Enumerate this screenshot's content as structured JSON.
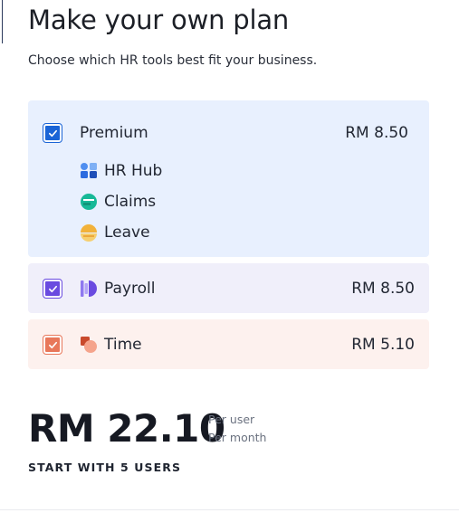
{
  "header": {
    "title": "Make your own plan",
    "subtitle": "Choose which HR tools best fit your business."
  },
  "plans": {
    "premium": {
      "name": "Premium",
      "price": "RM 8.50",
      "checked": true,
      "color": "#1a64d6",
      "features": [
        {
          "label": "HR Hub",
          "icon": "hr-hub-icon"
        },
        {
          "label": "Claims",
          "icon": "claims-icon"
        },
        {
          "label": "Leave",
          "icon": "leave-icon"
        }
      ]
    },
    "payroll": {
      "name": "Payroll",
      "price": "RM 8.50",
      "checked": true,
      "color": "#6a4be0",
      "icon": "payroll-icon"
    },
    "time": {
      "name": "Time",
      "price": "RM 5.10",
      "checked": true,
      "color": "#e8775a",
      "icon": "time-icon"
    }
  },
  "summary": {
    "total": "RM 22.10",
    "per_user": "Per user",
    "per_month": "Per month",
    "cta": "START WITH 5 USERS"
  }
}
